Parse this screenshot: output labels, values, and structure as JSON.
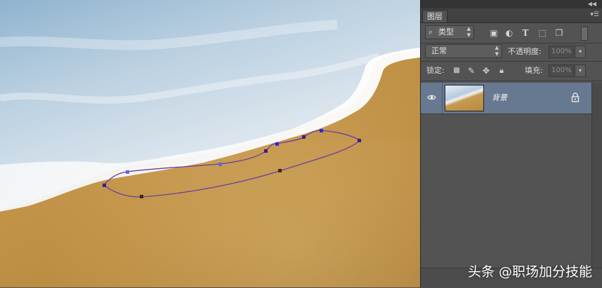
{
  "panel": {
    "tab_title": "图层",
    "filter_label": "类型",
    "blend_mode": "正常",
    "opacity_label": "不透明度:",
    "opacity_value": "100%",
    "lock_label": "锁定:",
    "fill_label": "填充:",
    "fill_value": "100%"
  },
  "layers": [
    {
      "name": "背景",
      "visible": true,
      "locked": true,
      "selected": true
    }
  ],
  "colors": {
    "selected_layer": "#677891",
    "panel_bg": "#535353",
    "path_stroke": "#6a3fa0",
    "anchor": "#3b1e8c"
  },
  "watermark": "头条 @职场加分技能"
}
